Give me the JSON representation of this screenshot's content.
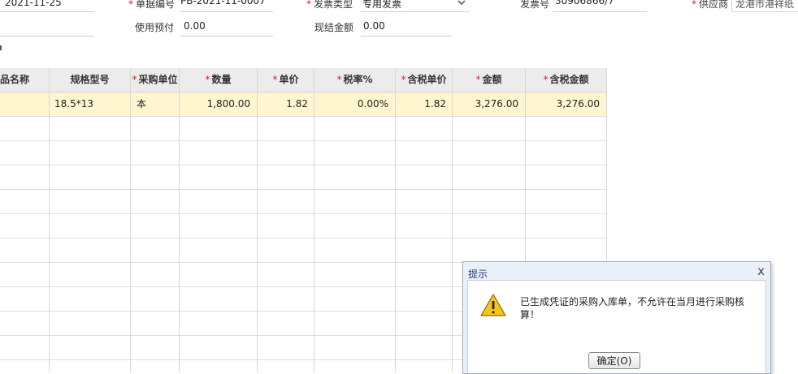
{
  "form": {
    "date": "2021-11-25",
    "doc_no_label": "单据编号",
    "doc_no": "PB-2021-11-0007",
    "invoice_type_label": "发票类型",
    "invoice_type": "专用发票",
    "invoice_no_label": "发票号",
    "invoice_no": "30906866/7",
    "supplier_label": "供应商",
    "supplier": "龙港市港祥纸",
    "prepay_label": "使用预付",
    "prepay": "0.00",
    "cash_label": "现结金额",
    "cash": "0.00"
  },
  "table": {
    "headers": [
      "品名称",
      "规格型号",
      "采购单位",
      "数量",
      "单价",
      "税率%",
      "含税单价",
      "金额",
      "含税金额"
    ],
    "row": {
      "spec": "18.5*13",
      "unit": "本",
      "qty": "1,800.00",
      "price": "1.82",
      "tax_rate": "0.00%",
      "price_tax": "1.82",
      "amount": "3,276.00",
      "amount_tax": "3,276.00"
    }
  },
  "dialog": {
    "title": "提示",
    "message": "已生成凭证的采购入库单，不允许在当月进行采购核算！",
    "ok_label": "确定(O)",
    "close_glyph": "x"
  },
  "colors": {
    "selected_row": "#fff6cf",
    "required": "#dd2222"
  }
}
